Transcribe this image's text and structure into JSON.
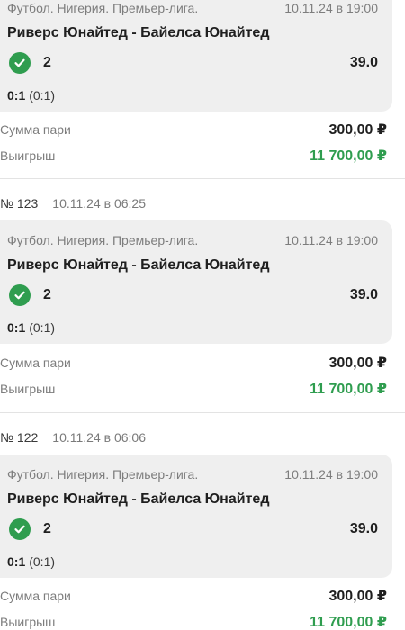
{
  "bets": [
    {
      "number": "",
      "placed": "",
      "league": "Футбол. Нигерия. Премьер-лига.",
      "event_time": "10.11.24 в 19:00",
      "teams": "Риверс Юнайтед - Байелса Юнайтед",
      "pick": "2",
      "odds": "39.0",
      "score": "0:1",
      "half_score": "(0:1)",
      "stake_label": "Сумма пари",
      "stake": "300,00 ₽",
      "win_label": "Выигрыш",
      "win": "11 700,00 ₽"
    },
    {
      "number": "№ 123",
      "placed": "10.11.24 в 06:25",
      "league": "Футбол. Нигерия. Премьер-лига.",
      "event_time": "10.11.24 в 19:00",
      "teams": "Риверс Юнайтед - Байелса Юнайтед",
      "pick": "2",
      "odds": "39.0",
      "score": "0:1",
      "half_score": "(0:1)",
      "stake_label": "Сумма пари",
      "stake": "300,00 ₽",
      "win_label": "Выигрыш",
      "win": "11 700,00 ₽"
    },
    {
      "number": "№ 122",
      "placed": "10.11.24 в 06:06",
      "league": "Футбол. Нигерия. Премьер-лига.",
      "event_time": "10.11.24 в 19:00",
      "teams": "Риверс Юнайтед - Байелса Юнайтед",
      "pick": "2",
      "odds": "39.0",
      "score": "0:1",
      "half_score": "(0:1)",
      "stake_label": "Сумма пари",
      "stake": "300,00 ₽",
      "win_label": "Выигрыш",
      "win": "11 700,00 ₽"
    }
  ],
  "colors": {
    "win_green": "#2f9d4f",
    "card_bg": "#efefef",
    "muted_text": "#7d7d7d"
  },
  "icons": {
    "pick_status": "check-circle-icon"
  }
}
